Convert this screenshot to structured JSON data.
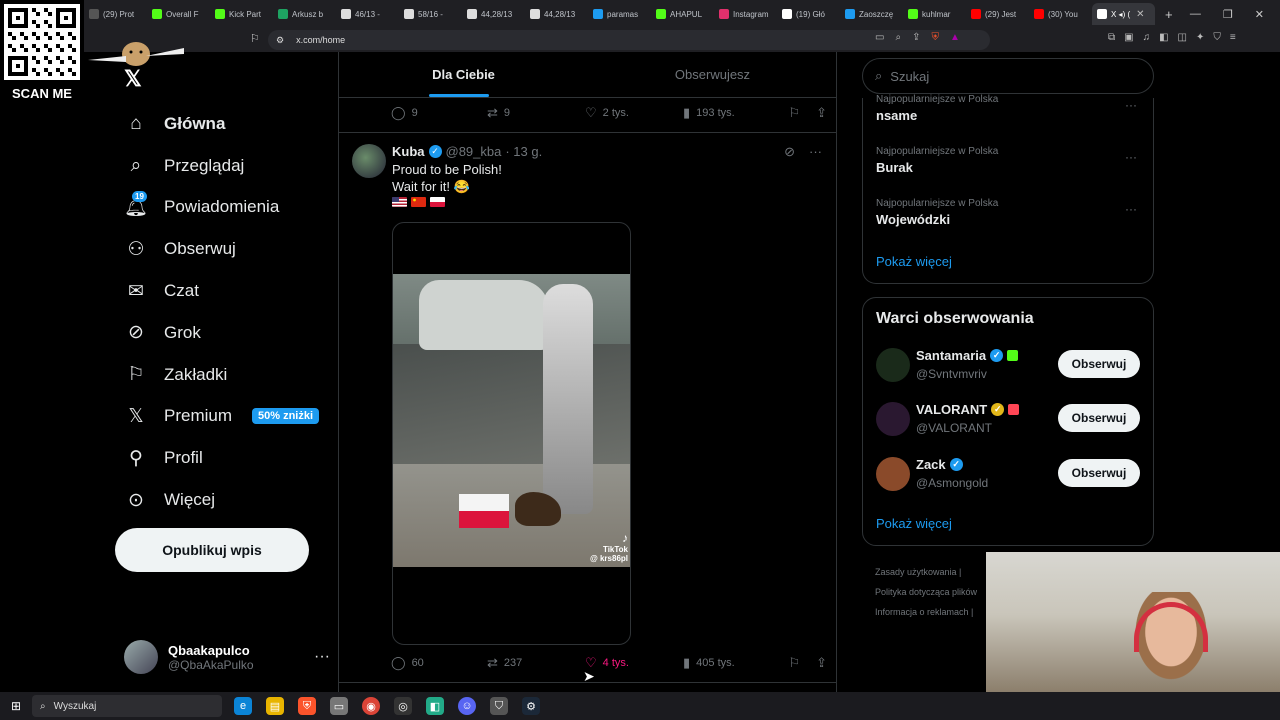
{
  "browser": {
    "tabs": [
      {
        "label": "(29) Prot",
        "color": "#555"
      },
      {
        "label": "Overall F",
        "color": "#53fc18"
      },
      {
        "label": "Kick Part",
        "color": "#53fc18"
      },
      {
        "label": "Arkusz b",
        "color": "#1ea362"
      },
      {
        "label": "46/13 -",
        "color": "#ddd"
      },
      {
        "label": "58/16 -",
        "color": "#ddd"
      },
      {
        "label": "44,28/13",
        "color": "#ddd"
      },
      {
        "label": "44,28/13",
        "color": "#ddd"
      },
      {
        "label": "paramas",
        "color": "#1d9bf0"
      },
      {
        "label": "AHAPUL",
        "color": "#53fc18"
      },
      {
        "label": "Instagram",
        "color": "#e1306c"
      },
      {
        "label": "(19) Głó",
        "color": "#fff"
      },
      {
        "label": "Zaoszczę",
        "color": "#1d9bf0"
      },
      {
        "label": "kuhlmar",
        "color": "#53fc18"
      },
      {
        "label": "(29) Jest",
        "color": "#ff0000"
      },
      {
        "label": "(30) You",
        "color": "#ff0000"
      },
      {
        "label": "X ◂) (",
        "color": "#fff",
        "active": true
      }
    ],
    "new_tab": "+",
    "url": "x.com/home"
  },
  "overlay": {
    "qr_label": "SCAN ME"
  },
  "nav": {
    "items": [
      {
        "label": "Główna",
        "icon": "home-icon",
        "glyph": "⌂",
        "active": true
      },
      {
        "label": "Przeglądaj",
        "icon": "search-icon",
        "glyph": "⌕"
      },
      {
        "label": "Powiadomienia",
        "icon": "bell-icon",
        "glyph": "🔔︎",
        "badge": "19"
      },
      {
        "label": "Obserwuj",
        "icon": "follow-icon",
        "glyph": "⚇"
      },
      {
        "label": "Czat",
        "icon": "mail-icon",
        "glyph": "✉"
      },
      {
        "label": "Grok",
        "icon": "grok-icon",
        "glyph": "⊘"
      },
      {
        "label": "Zakładki",
        "icon": "bookmark-icon",
        "glyph": "⚐"
      },
      {
        "label": "Premium",
        "icon": "x-premium-icon",
        "glyph": "𝕏",
        "tag": "50% zniżki"
      },
      {
        "label": "Profil",
        "icon": "profile-icon",
        "glyph": "⚲"
      },
      {
        "label": "Więcej",
        "icon": "more-icon",
        "glyph": "⊙"
      }
    ],
    "post_button": "Opublikuj wpis",
    "account": {
      "name": "Qbaakapulco",
      "handle": "@QbaAkaPulko"
    }
  },
  "feed": {
    "tabs": [
      "Dla Ciebie",
      "Obserwujesz"
    ],
    "prev_post_stats": {
      "replies": "9",
      "reposts": "9",
      "likes": "2 tys.",
      "views": "193 tys."
    },
    "post": {
      "author": "Kuba",
      "handle": "@89_kba",
      "time": "· 13 g.",
      "line1": "Proud to be Polish!",
      "line2": "Wait for it! 😂",
      "stats": {
        "replies": "60",
        "reposts": "237",
        "likes": "4 tys.",
        "views": "405 tys."
      },
      "video_watermark": "TikTok",
      "video_handle": "@ krs86pl"
    }
  },
  "sidebar": {
    "search_placeholder": "Szukaj",
    "trends": [
      {
        "category": "Najpopularniejsze w Polska",
        "name": "nsame"
      },
      {
        "category": "Najpopularniejsze w Polska",
        "name": "Burak"
      },
      {
        "category": "Najpopularniejsze w Polska",
        "name": "Wojewódzki"
      }
    ],
    "show_more": "Pokaż więcej",
    "who_to_follow": {
      "title": "Warci obserwowania",
      "follow_label": "Obserwuj",
      "users": [
        {
          "name": "Santamaria",
          "handle": "@Svntvmvriv",
          "verified": "blue",
          "avatar_color": "#1a2a1a",
          "aff_color": "#53fc18"
        },
        {
          "name": "VALORANT",
          "handle": "@VALORANT",
          "verified": "gold",
          "avatar_color": "#2a1830",
          "aff_color": "#ff4655"
        },
        {
          "name": "Zack",
          "handle": "@Asmongold",
          "verified": "blue",
          "avatar_color": "#8a4a2a",
          "aff_color": ""
        }
      ],
      "show_more": "Pokaż więcej"
    },
    "footer": [
      "Zasady użytkowania |",
      "Polityka dotycząca plików",
      "Informacja o reklamach |"
    ]
  },
  "taskbar": {
    "search": "Wyszukaj"
  },
  "colors": {
    "accent": "#1d9bf0",
    "like": "#f91880",
    "border": "#2f3336"
  }
}
